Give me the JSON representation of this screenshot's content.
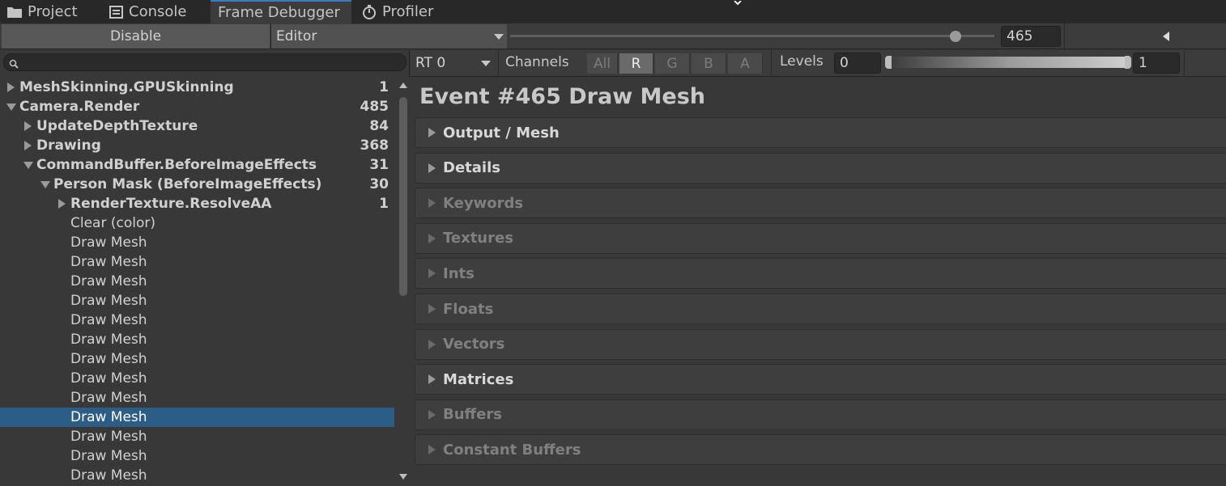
{
  "tabs": [
    {
      "label": "Project",
      "icon": "folder-icon"
    },
    {
      "label": "Console",
      "icon": "console-icon"
    },
    {
      "label": "Frame Debugger",
      "icon": "",
      "active": true
    },
    {
      "label": "Profiler",
      "icon": "stopwatch-icon"
    }
  ],
  "toolbar": {
    "disable_label": "Disable",
    "target_value": "Editor",
    "event_number": "465",
    "slider_position": 0.92
  },
  "tree": {
    "search_placeholder": "",
    "rows": [
      {
        "label": "MeshSkinning.GPUSkinning",
        "count": "1",
        "state": "collapsed",
        "depth": 0
      },
      {
        "label": "Camera.Render",
        "count": "485",
        "state": "expanded",
        "depth": 0
      },
      {
        "label": "UpdateDepthTexture",
        "count": "84",
        "state": "collapsed",
        "depth": 1
      },
      {
        "label": "Drawing",
        "count": "368",
        "state": "collapsed",
        "depth": 1
      },
      {
        "label": "CommandBuffer.BeforeImageEffects",
        "count": "31",
        "state": "expanded",
        "depth": 1
      },
      {
        "label": "Person Mask (BeforeImageEffects)",
        "count": "30",
        "state": "expanded",
        "depth": 2
      },
      {
        "label": "RenderTexture.ResolveAA",
        "count": "1",
        "state": "collapsed",
        "depth": 3
      },
      {
        "label": "Clear (color)",
        "count": "",
        "state": "leaf",
        "depth": 3
      },
      {
        "label": "Draw Mesh",
        "count": "",
        "state": "leaf",
        "depth": 3
      },
      {
        "label": "Draw Mesh",
        "count": "",
        "state": "leaf",
        "depth": 3
      },
      {
        "label": "Draw Mesh",
        "count": "",
        "state": "leaf",
        "depth": 3
      },
      {
        "label": "Draw Mesh",
        "count": "",
        "state": "leaf",
        "depth": 3
      },
      {
        "label": "Draw Mesh",
        "count": "",
        "state": "leaf",
        "depth": 3
      },
      {
        "label": "Draw Mesh",
        "count": "",
        "state": "leaf",
        "depth": 3
      },
      {
        "label": "Draw Mesh",
        "count": "",
        "state": "leaf",
        "depth": 3
      },
      {
        "label": "Draw Mesh",
        "count": "",
        "state": "leaf",
        "depth": 3
      },
      {
        "label": "Draw Mesh",
        "count": "",
        "state": "leaf",
        "depth": 3
      },
      {
        "label": "Draw Mesh",
        "count": "",
        "state": "leaf",
        "depth": 3,
        "selected": true
      },
      {
        "label": "Draw Mesh",
        "count": "",
        "state": "leaf",
        "depth": 3
      },
      {
        "label": "Draw Mesh",
        "count": "",
        "state": "leaf",
        "depth": 3
      },
      {
        "label": "Draw Mesh",
        "count": "",
        "state": "leaf",
        "depth": 3
      }
    ]
  },
  "render_toolbar": {
    "rt_value": "RT 0",
    "channels_label": "Channels",
    "channels": [
      {
        "label": "All",
        "on": false
      },
      {
        "label": "R",
        "on": true
      },
      {
        "label": "G",
        "on": false
      },
      {
        "label": "B",
        "on": false
      },
      {
        "label": "A",
        "on": false
      }
    ],
    "levels_label": "Levels",
    "levels_min": "0",
    "levels_max": "1"
  },
  "event": {
    "title": "Event #465 Draw Mesh",
    "sections": [
      {
        "label": "Output / Mesh",
        "enabled": true
      },
      {
        "label": "Details",
        "enabled": true
      },
      {
        "label": "Keywords",
        "enabled": false
      },
      {
        "label": "Textures",
        "enabled": false
      },
      {
        "label": "Ints",
        "enabled": false
      },
      {
        "label": "Floats",
        "enabled": false
      },
      {
        "label": "Vectors",
        "enabled": false
      },
      {
        "label": "Matrices",
        "enabled": true
      },
      {
        "label": "Buffers",
        "enabled": false
      },
      {
        "label": "Constant Buffers",
        "enabled": false
      }
    ]
  },
  "colors": {
    "selection": "#2c5d87",
    "tab_accent": "#3a79bb",
    "background": "#383838"
  }
}
